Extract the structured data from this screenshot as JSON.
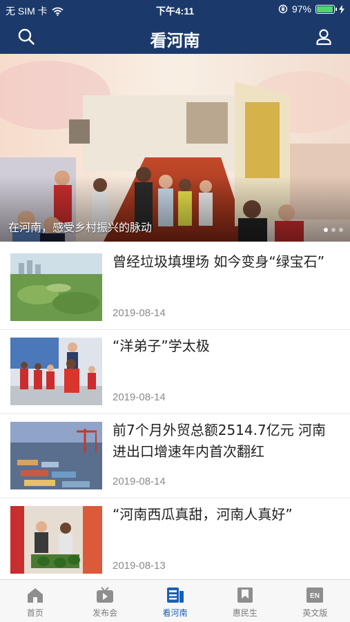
{
  "status_bar": {
    "carrier": "无 SIM 卡",
    "time": "下午4:11",
    "battery_percent": "97%",
    "battery_level": 0.97
  },
  "nav": {
    "title": "看河南",
    "left_icon": "search-icon",
    "right_icon": "user-icon"
  },
  "banner": {
    "caption": "在河南，感受乡村振兴的脉动",
    "slide_count": 3,
    "active_slide": 1
  },
  "news": [
    {
      "title": "曾经垃圾填埋场 如今变身“绿宝石”",
      "date": "2019-08-14"
    },
    {
      "title": "“洋弟子”学太极",
      "date": "2019-08-14"
    },
    {
      "title": "前7个月外贸总额2514.7亿元 河南进出口增速年内首次翻红",
      "date": "2019-08-14"
    },
    {
      "title": "“河南西瓜真甜，河南人真好”",
      "date": "2019-08-13"
    }
  ],
  "tabs": [
    {
      "label": "首页",
      "icon": "home-icon",
      "active": false
    },
    {
      "label": "发布会",
      "icon": "tv-icon",
      "active": false
    },
    {
      "label": "看河南",
      "icon": "article-icon",
      "active": true
    },
    {
      "label": "惠民生",
      "icon": "bookmark-icon",
      "active": false
    },
    {
      "label": "英文版",
      "icon": "en-icon",
      "active": false
    }
  ],
  "colors": {
    "header_bg": "#1b3a6b",
    "accent": "#1b5fb5",
    "tab_inactive": "#7a7a7a"
  }
}
